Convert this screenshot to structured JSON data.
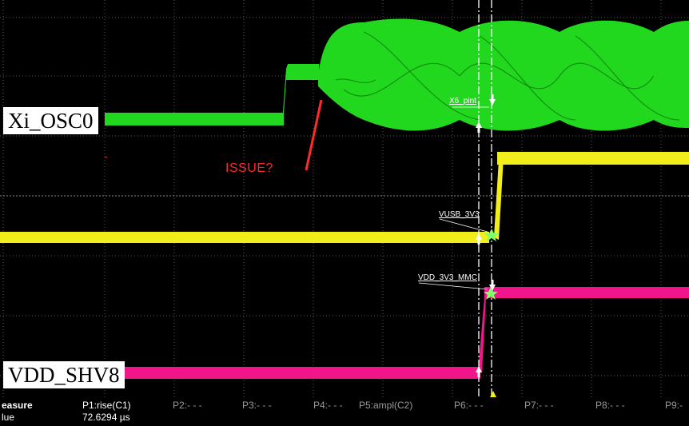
{
  "traces": {
    "osc_label": "Xi_OSC0",
    "shv_label": "VDD_SHV8"
  },
  "annotation": {
    "issue_text": "ISSUE?"
  },
  "cursors": {
    "x6_label": "X6_pint",
    "vusb_label": "VUSB_3V3",
    "vdd_mmc_label": "VDD_3V3_MMC"
  },
  "measure": {
    "row1_label": "easure",
    "row2_label": "lue",
    "p1_name": "P1:rise(C1)",
    "p1_value": "72.6294 µs",
    "p2": "P2:- - -",
    "p3": "P3:- - -",
    "p4": "P4:- - -",
    "p5": "P5:ampl(C2)",
    "p6": "P6:- - -",
    "p7": "P7:- - -",
    "p8": "P8:- - -",
    "p9": "P9:-"
  },
  "colors": {
    "background": "#000000",
    "grid": "#5a5a5a",
    "osc": "#22d81e",
    "yellow": "#f2ee1c",
    "magenta": "#f0168a",
    "annotation": "#ff2a2a"
  }
}
